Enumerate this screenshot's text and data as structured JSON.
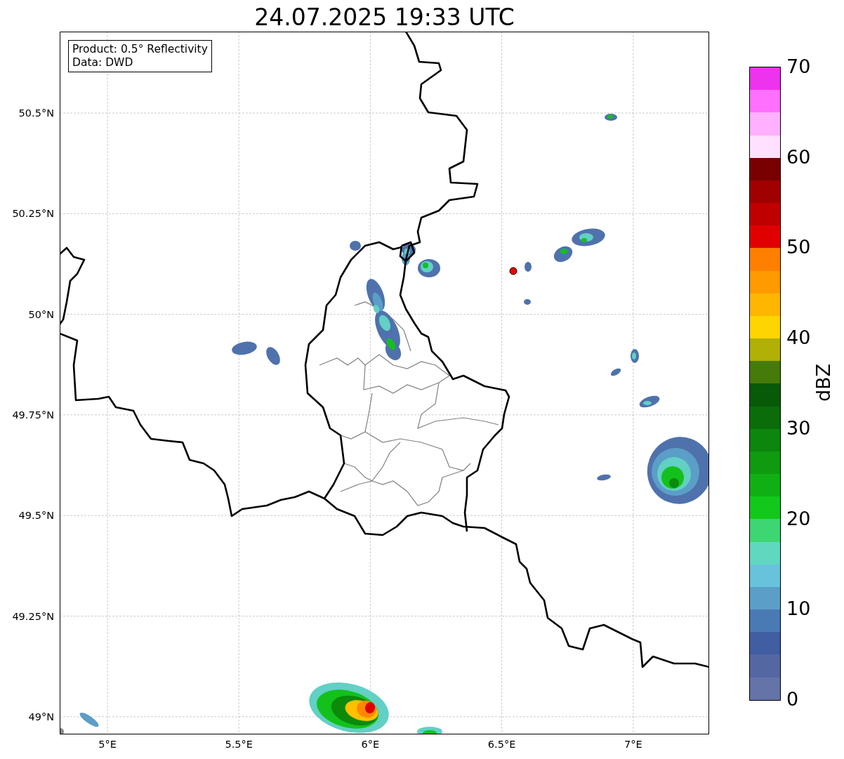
{
  "title": "24.07.2025 19:33 UTC",
  "legend": [
    "Product: 0.5° Reflectivity",
    "Data: DWD"
  ],
  "y_ticks": [
    "50.5°N",
    "50.25°N",
    "50°N",
    "49.75°N",
    "49.5°N",
    "49.25°N",
    "49°N"
  ],
  "x_ticks": [
    "5°E",
    "5.5°E",
    "6°E",
    "6.5°E",
    "7°E"
  ],
  "colorbar": {
    "label": "dBZ",
    "ticks": [
      "70",
      "60",
      "50",
      "40",
      "30",
      "20",
      "10",
      "0"
    ],
    "bins": [
      {
        "color": "#6473a8"
      },
      {
        "color": "#5567a3"
      },
      {
        "color": "#425ea3"
      },
      {
        "color": "#4a7ab4"
      },
      {
        "color": "#5b9ec8"
      },
      {
        "color": "#69c2dc"
      },
      {
        "color": "#60d8c0"
      },
      {
        "color": "#3dd672"
      },
      {
        "color": "#12c81a"
      },
      {
        "color": "#10b015"
      },
      {
        "color": "#0f9a10"
      },
      {
        "color": "#0c860c"
      },
      {
        "color": "#0a6d0a"
      },
      {
        "color": "#085a08"
      },
      {
        "color": "#467a0a"
      },
      {
        "color": "#b0b006"
      },
      {
        "color": "#ffd500"
      },
      {
        "color": "#ffb600"
      },
      {
        "color": "#ff9a00"
      },
      {
        "color": "#ff8000"
      },
      {
        "color": "#e00000"
      },
      {
        "color": "#c00000"
      },
      {
        "color": "#a00000"
      },
      {
        "color": "#780000"
      },
      {
        "color": "#ffe0ff"
      },
      {
        "color": "#ffb0ff"
      },
      {
        "color": "#ff70ff"
      },
      {
        "color": "#ee33ee"
      }
    ]
  }
}
